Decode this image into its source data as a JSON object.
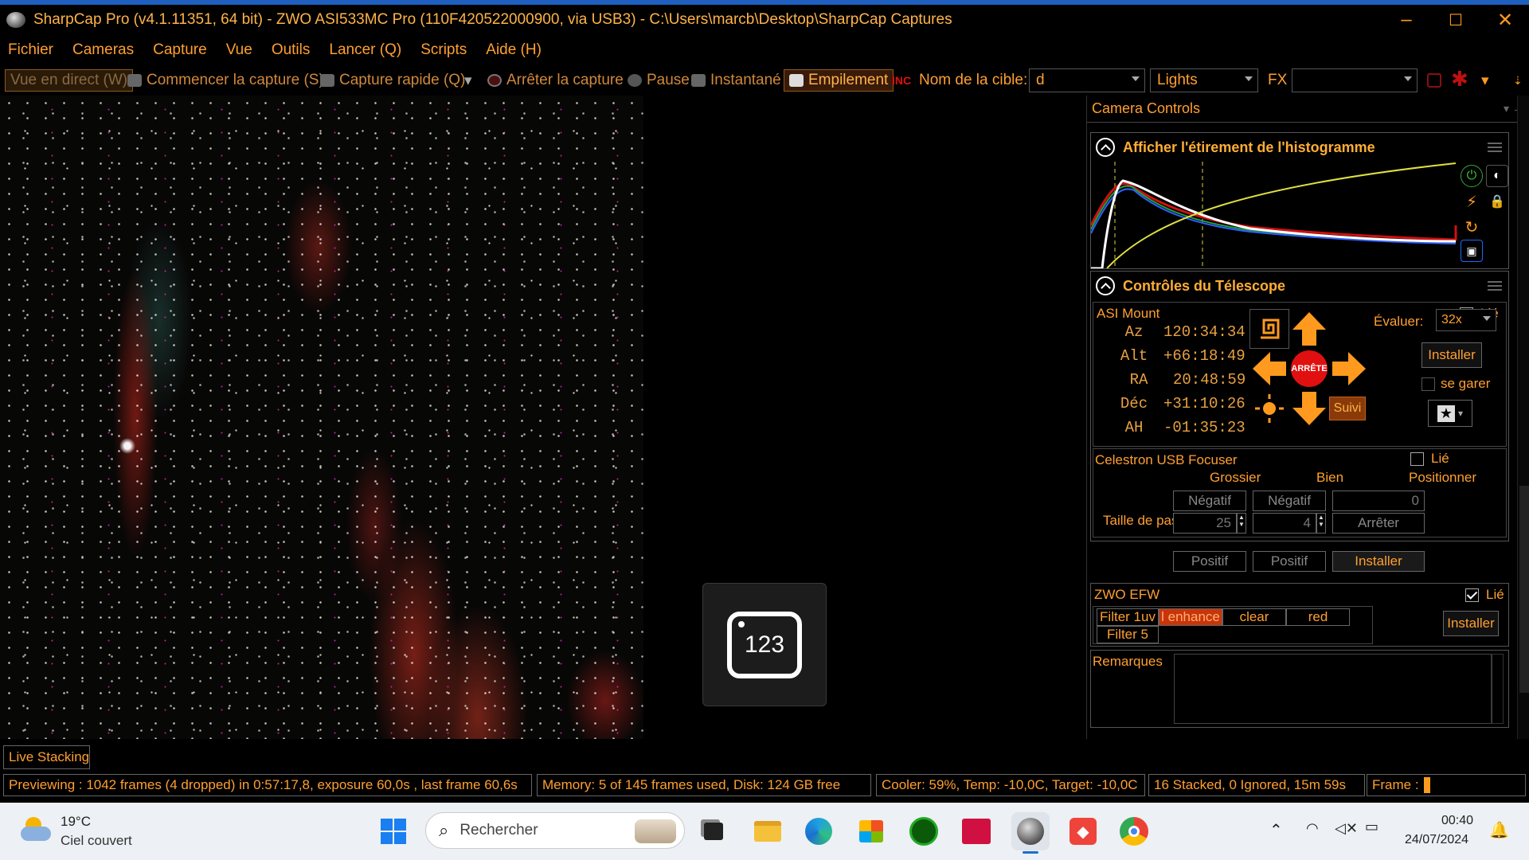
{
  "window": {
    "title": "SharpCap Pro (v4.1.11351, 64 bit) - ZWO ASI533MC Pro (110F420522000900, via USB3) - C:\\Users\\marcb\\Desktop\\SharpCap Captures",
    "minimize": "–",
    "maximize": "☐",
    "close": "✕"
  },
  "menu": [
    "Fichier",
    "Cameras",
    "Capture",
    "Vue",
    "Outils",
    "Lancer (Q)",
    "Scripts",
    "Aide (H)"
  ],
  "toolbar": {
    "live_view": "Vue en direct (W)",
    "start_capture": "Commencer la capture (S)",
    "quick_capture": "Capture rapide (Q)",
    "stop_capture": "Arrêter la capture",
    "pause": "Pause",
    "snapshot": "Instantané",
    "stacking": "Empilement",
    "target_label": "Nom de la cible:",
    "target_value": "d",
    "frame_type": "Lights",
    "fx_label": "FX",
    "fx_value": ""
  },
  "counter_tile": "123",
  "panel": {
    "title": "Camera Controls",
    "histogram": {
      "title": "Afficher l'étirement de l'histogramme"
    },
    "telescope": {
      "title": "Contrôles du Télescope",
      "mount_name": "ASI Mount",
      "linked_label": "Lié",
      "coords": [
        {
          "label": "Az",
          "value": "120:34:34"
        },
        {
          "label": "Alt",
          "value": "+66:18:49"
        },
        {
          "label": "RA",
          "value": "20:48:59"
        },
        {
          "label": "Déc",
          "value": "+31:10:26"
        },
        {
          "label": "AH",
          "value": "-01:35:23"
        }
      ],
      "stop_label": "ARRÊTE",
      "rate_label": "Évaluer:",
      "rate_value": "32x",
      "setup_label": "Installer",
      "park_label": "se garer",
      "tracking_label": "Suivi"
    },
    "focuser": {
      "name": "Celestron USB Focuser",
      "linked_label": "Lié",
      "col_coarse": "Grossier",
      "col_fine": "Bien",
      "col_position": "Positionner",
      "step_size_label": "Taille de pas",
      "negative": "Négatif",
      "positive": "Positif",
      "coarse_step": "25",
      "fine_step": "4",
      "position_value": "0",
      "stop": "Arrêter",
      "setup": "Installer"
    },
    "filterwheel": {
      "name": "ZWO EFW",
      "linked_label": "Lié",
      "filters": [
        "Filter 1uv",
        "l enhance",
        "clear",
        "red",
        "Filter 5"
      ],
      "active_index": 1,
      "setup": "Installer"
    },
    "notes_label": "Remarques"
  },
  "tabs": {
    "live_stacking": "Live Stacking"
  },
  "status": {
    "preview": "Previewing : 1042 frames (4 dropped) in 0:57:17,8, exposure 60,0s , last frame 60,6s",
    "memory": "Memory: 5 of 145 frames used, Disk: 124 GB free",
    "cooler": "Cooler: 59%, Temp: -10,0C, Target: -10,0C",
    "stacked": "16 Stacked, 0 Ignored, 15m 59s",
    "frame": "Frame :"
  },
  "taskbar": {
    "weather_temp": "19°C",
    "weather_desc": "Ciel couvert",
    "search_placeholder": "Rechercher",
    "time": "00:40",
    "date": "24/07/2024"
  },
  "colors": {
    "accent": "#ff9f30",
    "stop_red": "#e01010",
    "arrow_orange": "#ff9a1f",
    "active_filter": "#c8350a"
  }
}
